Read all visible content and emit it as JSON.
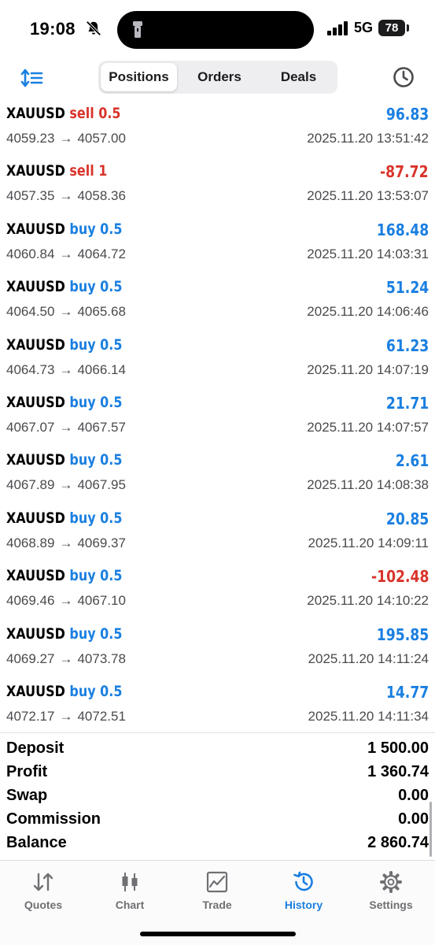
{
  "status_bar": {
    "time": "19:08",
    "network": "5G",
    "battery": "78"
  },
  "top_bar": {
    "tabs": [
      {
        "label": "Positions",
        "active": true
      },
      {
        "label": "Orders",
        "active": false
      },
      {
        "label": "Deals",
        "active": false
      }
    ]
  },
  "deals": [
    {
      "symbol": "XAUUSD",
      "side": "sell 0.5",
      "direction": "sell",
      "open": "4059.23",
      "close": "4057.00",
      "datetime": "2025.11.20 13:51:42",
      "profit": "96.83",
      "profit_sign": "pos"
    },
    {
      "symbol": "XAUUSD",
      "side": "sell 1",
      "direction": "sell",
      "open": "4057.35",
      "close": "4058.36",
      "datetime": "2025.11.20 13:53:07",
      "profit": "-87.72",
      "profit_sign": "neg"
    },
    {
      "symbol": "XAUUSD",
      "side": "buy 0.5",
      "direction": "buy",
      "open": "4060.84",
      "close": "4064.72",
      "datetime": "2025.11.20 14:03:31",
      "profit": "168.48",
      "profit_sign": "pos"
    },
    {
      "symbol": "XAUUSD",
      "side": "buy 0.5",
      "direction": "buy",
      "open": "4064.50",
      "close": "4065.68",
      "datetime": "2025.11.20 14:06:46",
      "profit": "51.24",
      "profit_sign": "pos"
    },
    {
      "symbol": "XAUUSD",
      "side": "buy 0.5",
      "direction": "buy",
      "open": "4064.73",
      "close": "4066.14",
      "datetime": "2025.11.20 14:07:19",
      "profit": "61.23",
      "profit_sign": "pos"
    },
    {
      "symbol": "XAUUSD",
      "side": "buy 0.5",
      "direction": "buy",
      "open": "4067.07",
      "close": "4067.57",
      "datetime": "2025.11.20 14:07:57",
      "profit": "21.71",
      "profit_sign": "pos"
    },
    {
      "symbol": "XAUUSD",
      "side": "buy 0.5",
      "direction": "buy",
      "open": "4067.89",
      "close": "4067.95",
      "datetime": "2025.11.20 14:08:38",
      "profit": "2.61",
      "profit_sign": "pos"
    },
    {
      "symbol": "XAUUSD",
      "side": "buy 0.5",
      "direction": "buy",
      "open": "4068.89",
      "close": "4069.37",
      "datetime": "2025.11.20 14:09:11",
      "profit": "20.85",
      "profit_sign": "pos"
    },
    {
      "symbol": "XAUUSD",
      "side": "buy 0.5",
      "direction": "buy",
      "open": "4069.46",
      "close": "4067.10",
      "datetime": "2025.11.20 14:10:22",
      "profit": "-102.48",
      "profit_sign": "neg"
    },
    {
      "symbol": "XAUUSD",
      "side": "buy 0.5",
      "direction": "buy",
      "open": "4069.27",
      "close": "4073.78",
      "datetime": "2025.11.20 14:11:24",
      "profit": "195.85",
      "profit_sign": "pos"
    },
    {
      "symbol": "XAUUSD",
      "side": "buy 0.5",
      "direction": "buy",
      "open": "4072.17",
      "close": "4072.51",
      "datetime": "2025.11.20 14:11:34",
      "profit": "14.77",
      "profit_sign": "pos"
    }
  ],
  "arrow": "→",
  "summary": {
    "deposit_label": "Deposit",
    "deposit": "1 500.00",
    "profit_label": "Profit",
    "profit": "1 360.74",
    "swap_label": "Swap",
    "swap": "0.00",
    "commission_label": "Commission",
    "commission": "0.00",
    "balance_label": "Balance",
    "balance": "2 860.74"
  },
  "tab_bar": {
    "quotes": "Quotes",
    "chart": "Chart",
    "trade": "Trade",
    "history": "History",
    "settings": "Settings",
    "active": "history"
  },
  "colors": {
    "accent": "#1a7fe0",
    "loss": "#d9342b",
    "text_muted": "#4a4a4e"
  },
  "icons": [
    "bell-slash-icon",
    "flashlight-icon",
    "signal-icon",
    "sort-icon",
    "clock-icon",
    "quotes-icon",
    "chart-icon",
    "trade-icon",
    "history-icon",
    "settings-icon"
  ]
}
